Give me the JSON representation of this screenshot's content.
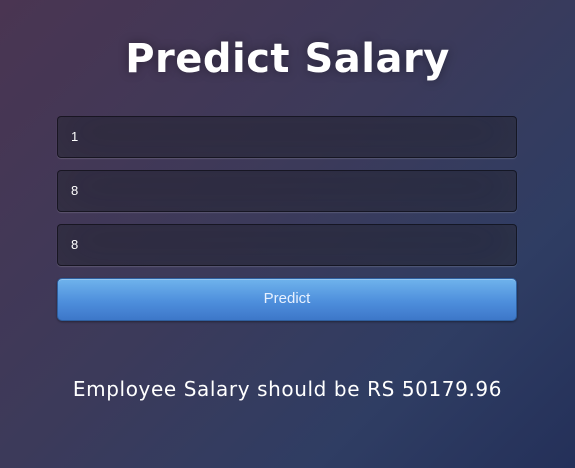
{
  "page": {
    "title": "Predict Salary"
  },
  "form": {
    "fields": [
      {
        "value": "1"
      },
      {
        "value": "8"
      },
      {
        "value": "8"
      }
    ],
    "submit_label": "Predict"
  },
  "result": {
    "text": "Employee Salary should be RS 50179.96"
  },
  "colors": {
    "button": "#4e8fdc",
    "background_start": "#4a3552",
    "background_end": "#243059",
    "text": "#ffffff"
  }
}
